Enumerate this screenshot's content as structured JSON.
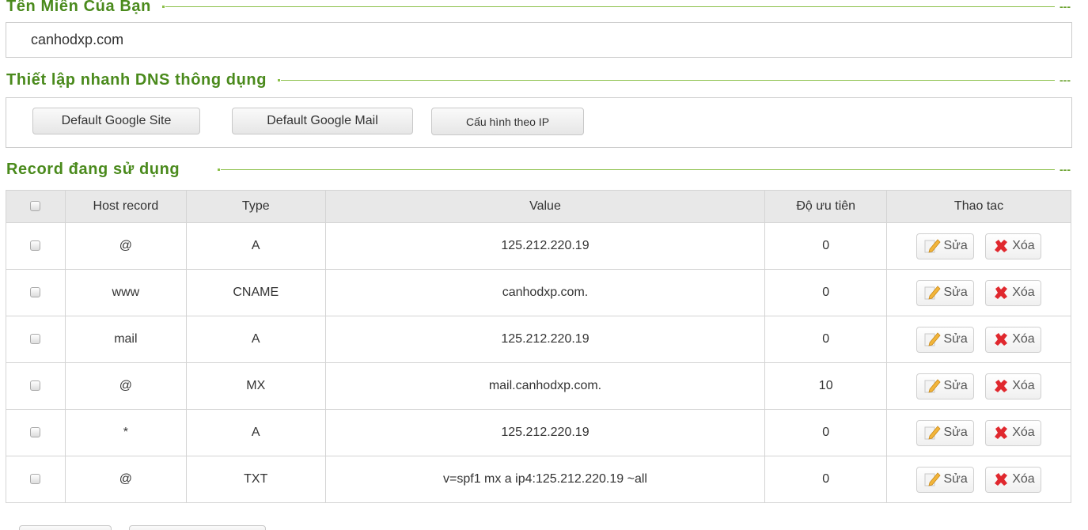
{
  "sections": {
    "domain_title": "Tên Miền Của Bạn",
    "quick_title": "Thiết lập nhanh DNS thông dụng",
    "records_title": "Record đang sử dụng",
    "dash": "---"
  },
  "domain": {
    "value": "canhodxp.com"
  },
  "quick_buttons": {
    "google_site": "Default Google Site",
    "google_mail": "Default Google Mail",
    "by_ip": "Cấu hình theo IP"
  },
  "table": {
    "headers": {
      "host": "Host record",
      "type": "Type",
      "value": "Value",
      "priority": "Độ ưu tiên",
      "actions": "Thao tac"
    },
    "edit_label": "Sửa",
    "delete_label": "Xóa",
    "rows": [
      {
        "host": "@",
        "type": "A",
        "value": "125.212.220.19",
        "priority": "0"
      },
      {
        "host": "www",
        "type": "CNAME",
        "value": "canhodxp.com.",
        "priority": "0"
      },
      {
        "host": "mail",
        "type": "A",
        "value": "125.212.220.19",
        "priority": "0"
      },
      {
        "host": "@",
        "type": "MX",
        "value": "mail.canhodxp.com.",
        "priority": "10"
      },
      {
        "host": "*",
        "type": "A",
        "value": "125.212.220.19",
        "priority": "0"
      },
      {
        "host": "@",
        "type": "TXT",
        "value": "v=spf1 mx a ip4:125.212.220.19 ~all",
        "priority": "0"
      }
    ]
  },
  "icons": {
    "edit": "pencil-edit-icon",
    "delete": "red-x-delete-icon",
    "checkbox": "checkbox-icon"
  },
  "colors": {
    "section_title": "#4a8a1c",
    "section_line": "#8cc04a",
    "table_header_bg": "#e8e8e8",
    "delete_icon": "#e0282e"
  }
}
